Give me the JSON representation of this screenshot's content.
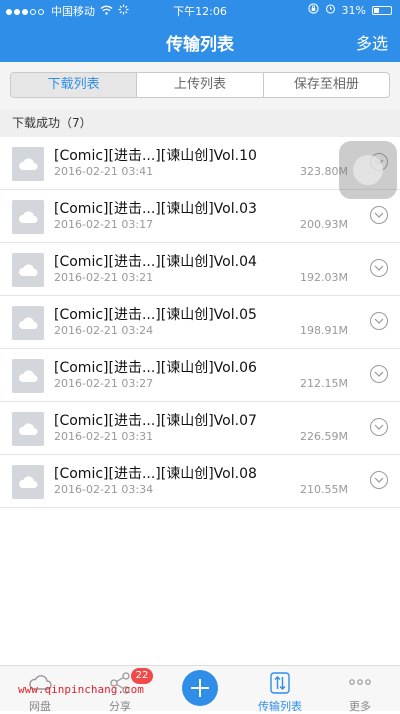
{
  "status_bar": {
    "carrier": "中国移动",
    "time": "下午12:06",
    "battery": "31%",
    "battery_level": 0.31
  },
  "nav": {
    "title": "传输列表",
    "action": "多选"
  },
  "segments": [
    {
      "label": "下载列表",
      "active": true
    },
    {
      "label": "上传列表",
      "active": false
    },
    {
      "label": "保存至相册",
      "active": false
    }
  ],
  "section": {
    "title": "下载成功（7）"
  },
  "files": [
    {
      "name": "[Comic][进击...][谏山创]Vol.10",
      "date": "2016-02-21 03:41",
      "size": "323.80M"
    },
    {
      "name": "[Comic][进击...][谏山创]Vol.03",
      "date": "2016-02-21 03:17",
      "size": "200.93M"
    },
    {
      "name": "[Comic][进击...][谏山创]Vol.04",
      "date": "2016-02-21 03:21",
      "size": "192.03M"
    },
    {
      "name": "[Comic][进击...][谏山创]Vol.05",
      "date": "2016-02-21 03:24",
      "size": "198.91M"
    },
    {
      "name": "[Comic][进击...][谏山创]Vol.06",
      "date": "2016-02-21 03:27",
      "size": "212.15M"
    },
    {
      "name": "[Comic][进击...][谏山创]Vol.07",
      "date": "2016-02-21 03:31",
      "size": "226.59M"
    },
    {
      "name": "[Comic][进击...][谏山创]Vol.08",
      "date": "2016-02-21 03:34",
      "size": "210.55M"
    }
  ],
  "tabbar": {
    "tabs": [
      {
        "label": "网盘",
        "icon": "cloud-icon"
      },
      {
        "label": "分享",
        "icon": "share-icon",
        "badge": "22"
      },
      {
        "label": "",
        "icon": "plus-icon"
      },
      {
        "label": "传输列表",
        "icon": "transfer-icon",
        "active": true
      },
      {
        "label": "更多",
        "icon": "more-icon"
      }
    ]
  },
  "watermark": "www.qinpinchang.com",
  "colors": {
    "accent": "#2f8ee8",
    "badge": "#f24a4a",
    "watermark": "#e0242f"
  }
}
